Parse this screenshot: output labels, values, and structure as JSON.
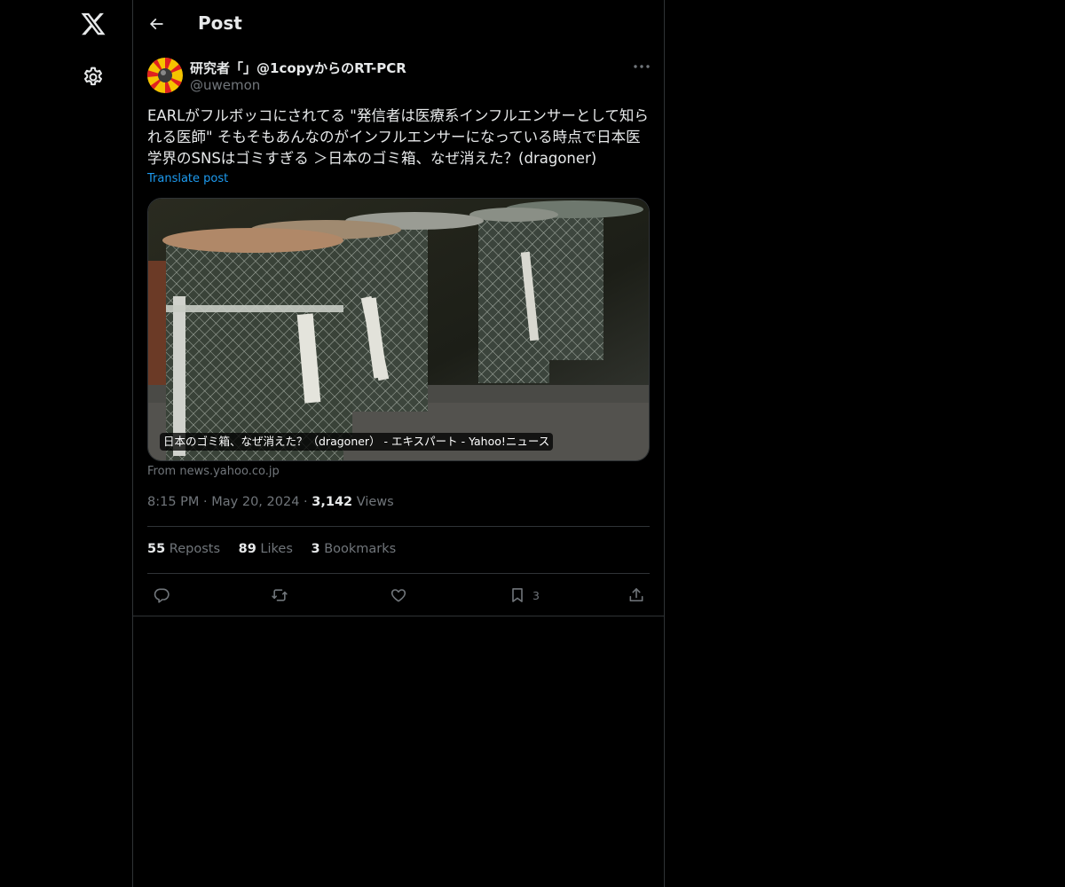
{
  "nav": {
    "logo_icon": "x-logo-icon",
    "settings_icon": "gear-icon"
  },
  "header": {
    "back_icon": "arrow-left-icon",
    "title": "Post"
  },
  "post": {
    "author_name": "研究者「」@1copyからのRT-PCR",
    "author_handle": "@uwemon",
    "text": "EARLがフルボッコにされてる \"発信者は医療系インフルエンサーとして知られる医師\" そもそもあんなのがインフルエンサーになっている時点で日本医学界のSNSはゴミすぎる ＞日本のゴミ箱、なぜ消えた？(dragoner)",
    "translate_label": "Translate post",
    "card": {
      "caption": "日本のゴミ箱、なぜ消えた？（dragoner） - エキスパート - Yahoo!ニュース",
      "source": "From news.yahoo.co.jp"
    },
    "time": "8:15 PM",
    "date": "May 20, 2024",
    "views_count": "3,142",
    "views_label": "Views",
    "stats": {
      "reposts_count": "55",
      "reposts_label": "Reposts",
      "likes_count": "89",
      "likes_label": "Likes",
      "bookmarks_count": "3",
      "bookmarks_label": "Bookmarks"
    },
    "actions": {
      "bookmark_count": "3"
    }
  },
  "colors": {
    "background": "#000000",
    "border": "#2f3336",
    "text": "#e7e9ea",
    "muted": "#71767b",
    "accent": "#1d9bf0"
  }
}
